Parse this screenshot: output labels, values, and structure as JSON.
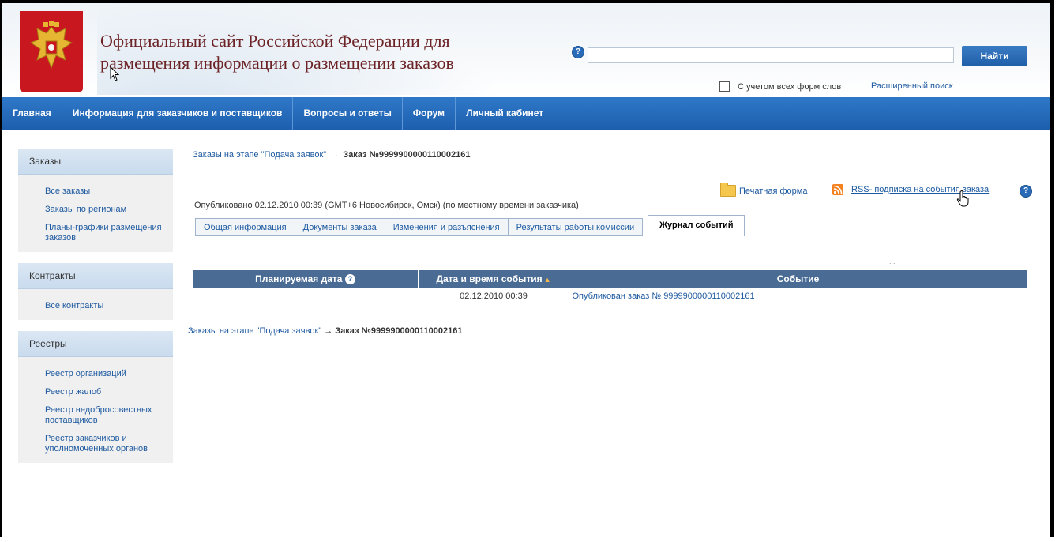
{
  "header": {
    "title_line1": "Официальный сайт Российской Федерации для",
    "title_line2": "размещения информации о размещении заказов",
    "search_placeholder": "",
    "search_button": "Найти",
    "allforms_label": "С учетом всех форм слов",
    "advanced_search": "Расширенный поиск",
    "help_glyph": "?"
  },
  "nav": {
    "items": [
      "Главная",
      "Информация для заказчиков и поставщиков",
      "Вопросы и ответы",
      "Форум",
      "Личный кабинет"
    ]
  },
  "sidebar": {
    "sections": [
      {
        "title": "Заказы",
        "links": [
          "Все заказы",
          "Заказы по регионам",
          "Планы-графики размещения заказов"
        ]
      },
      {
        "title": "Контракты",
        "links": [
          "Все контракты"
        ]
      },
      {
        "title": "Реестры",
        "links": [
          "Реестр организаций",
          "Реестр жалоб",
          "Реестр недобросовестных поставщиков",
          "Реестр заказчиков и уполномоченных органов"
        ]
      }
    ]
  },
  "main": {
    "breadcrumb_link": "Заказы на этапе \"Подача заявок\"",
    "breadcrumb_arrow": "→",
    "breadcrumb_current": "Заказ №9999900000110002161",
    "print_form": "Печатная форма",
    "rss_link": "RSS- подписка на события заказа",
    "published": "Опубликовано 02.12.2010 00:39 (GMT+6 Новосибирск, Омск) (по местному времени заказчика)",
    "tabs": [
      "Общая информация",
      "Документы заказа",
      "Изменения и разъяснения",
      "Результаты работы комиссии"
    ],
    "active_tab": "Журнал событий",
    "table": {
      "headers": [
        "Планируемая дата",
        "Дата и время события",
        "Событие"
      ],
      "sort_glyph": "▲",
      "rows": [
        {
          "planned": "",
          "datetime": "02.12.2010 00:39",
          "event": "Опубликован заказ № 9999900000110002161"
        }
      ]
    },
    "dots": ". ."
  },
  "colors": {
    "nav_blue": "#1d5fae",
    "emblem_red": "#c8171e",
    "title_color": "#6b2326",
    "link_blue": "#1e5aa0",
    "table_header": "#4a6b94"
  }
}
